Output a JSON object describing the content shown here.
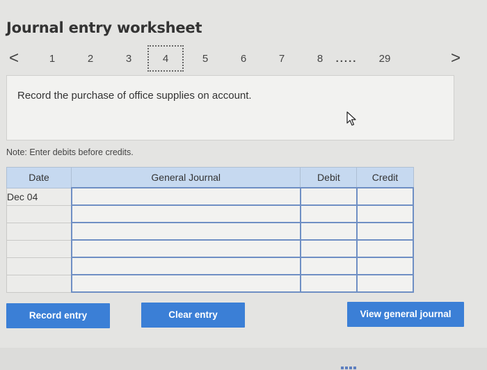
{
  "header": {
    "title": "Journal entry worksheet"
  },
  "pager": {
    "prev_glyph": "<",
    "next_glyph": ">",
    "pages": [
      "1",
      "2",
      "3",
      "4",
      "5",
      "6",
      "7",
      "8"
    ],
    "current": "4",
    "ellipsis": ".....",
    "last": "29"
  },
  "prompt": {
    "text": "Record the purchase of office supplies on account."
  },
  "note": {
    "text": "Note: Enter debits before credits."
  },
  "journal": {
    "headers": {
      "date": "Date",
      "account": "General Journal",
      "debit": "Debit",
      "credit": "Credit"
    },
    "rows": [
      {
        "date": "Dec 04",
        "account": "",
        "debit": "",
        "credit": ""
      },
      {
        "date": "",
        "account": "",
        "debit": "",
        "credit": ""
      },
      {
        "date": "",
        "account": "",
        "debit": "",
        "credit": ""
      },
      {
        "date": "",
        "account": "",
        "debit": "",
        "credit": ""
      },
      {
        "date": "",
        "account": "",
        "debit": "",
        "credit": ""
      },
      {
        "date": "",
        "account": "",
        "debit": "",
        "credit": ""
      }
    ]
  },
  "buttons": {
    "record": "Record entry",
    "clear": "Clear entry",
    "view": "View general journal"
  },
  "colors": {
    "accent": "#3b7fd6",
    "header_bg": "#c6d9f0",
    "input_border": "#6f8fc4"
  }
}
